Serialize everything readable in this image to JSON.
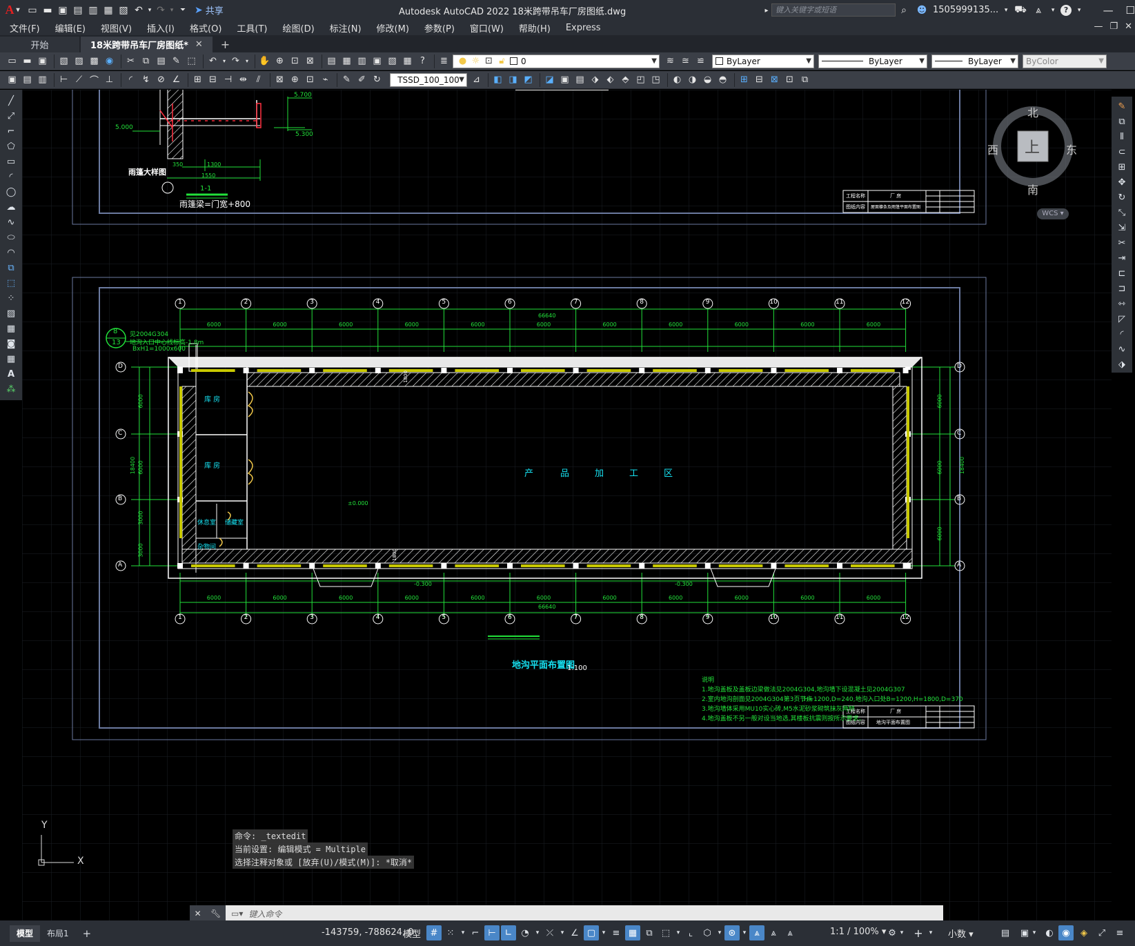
{
  "app": {
    "logo": "A",
    "title": "Autodesk AutoCAD 2022    18米跨带吊车厂房图纸.dwg",
    "share_label": "共享",
    "search_placeholder": "键入关键字或短语",
    "user": "1505999135...",
    "help": "?"
  },
  "menu": [
    "文件(F)",
    "编辑(E)",
    "视图(V)",
    "插入(I)",
    "格式(O)",
    "工具(T)",
    "绘图(D)",
    "标注(N)",
    "修改(M)",
    "参数(P)",
    "窗口(W)",
    "帮助(H)",
    "Express"
  ],
  "tabs": [
    {
      "label": "开始",
      "active": false
    },
    {
      "label": "18米跨带吊车厂房图纸*",
      "active": true
    }
  ],
  "toolbar": {
    "layer_value": "0",
    "color_value": "ByLayer",
    "linetype_value": "ByLayer",
    "lineweight_value": "ByLayer",
    "plotstyle_value": "ByColor",
    "dimstyle_value": "TSSD_100_100"
  },
  "viewcube": {
    "north": "北",
    "south": "南",
    "east": "东",
    "west": "西",
    "top": "上",
    "wcs": "WCS"
  },
  "drawing": {
    "upper_detail": {
      "title": "雨篷大样图",
      "section_label": "1-1",
      "beam_note": "雨篷梁=门宽+800",
      "dims": [
        "350",
        "1300",
        "1550"
      ],
      "elevations": [
        "5.700",
        "5.300",
        "5.000"
      ]
    },
    "plan": {
      "title": "地沟平面布置图",
      "scale": "1:100",
      "axes_top": [
        "1",
        "2",
        "3",
        "4",
        "5",
        "6",
        "7",
        "8",
        "9",
        "10",
        "11",
        "12"
      ],
      "axes_side": [
        "D",
        "C",
        "B",
        "A"
      ],
      "bay_dim": "6000",
      "total_dim": "66640",
      "height_total": "18400",
      "left_dims": [
        "6000",
        "6000",
        "3000",
        "3000"
      ],
      "right_dims": [
        "6000",
        "6000",
        "6000"
      ],
      "zone_label": [
        "产",
        "品",
        "加",
        "工",
        "区"
      ],
      "rooms": [
        "库 房",
        "库 房",
        "休息室",
        "储藏室",
        "杂物间"
      ],
      "elev_zero": "±0.000",
      "elev_ramp": [
        "-0.300",
        "-0.300"
      ],
      "callout_top": "8",
      "callout_bottom": "13",
      "callout_note1": "见2004G304",
      "callout_note2": "地沟入口中心线标高-1.8m",
      "callout_note3": "BxH1=1000x600",
      "mid_dims": [
        "1800",
        "1800"
      ],
      "notes_title": "说明",
      "notes": [
        "1.地沟盖板及盖板边梁做法见2004G304,地沟墙下设混凝土见2004G307",
        "2.室内地沟剖面见2004G304第3页节点",
        ",H=1200,D=240,地沟入口处B=1200,H=1800,D=370",
        "3.地沟墙体采用MU10实心砖,M5水泥砂浆砌筑抹灰两侧",
        "4.地沟盖板不另一般对设当地选,其楼板抗震则按所示要求。"
      ]
    },
    "title_block": {
      "project_label": "工程名称",
      "project_value": "厂 房",
      "content_label": "图纸内容",
      "content_upper": "屋面檩条及雨篷平面布置图",
      "content_lower": "地沟平面布置图"
    }
  },
  "command": {
    "history": [
      "命令: _textedit",
      "当前设置: 编辑模式 = Multiple",
      "选择注释对象或 [放弃(U)/模式(M)]: *取消*"
    ],
    "prompt": "键入命令"
  },
  "statusbar": {
    "tabs": [
      {
        "label": "模型",
        "active": true
      },
      {
        "label": "布局1",
        "active": false
      }
    ],
    "coords": "-143759, -788624, 0",
    "space": "模型",
    "scale": "1:1 / 100%",
    "units": "小数"
  },
  "ucs": {
    "y": "Y",
    "x": "X"
  }
}
